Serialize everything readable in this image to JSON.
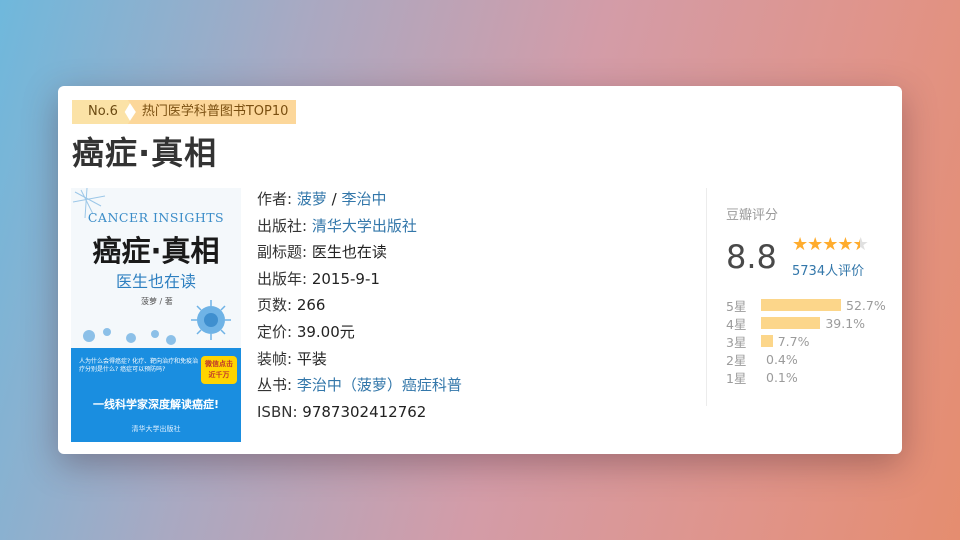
{
  "ranking": {
    "no": "No.6",
    "list": "热门医学科普图书TOP10"
  },
  "book": {
    "title": "癌症·真相",
    "cover": {
      "en_title": "CANCER INSIGHTS",
      "cn_title": "癌症·真相",
      "subtitle": "医生也在读",
      "author": "菠萝 / 著",
      "questions": "人为什么会得癌症? 化疗、靶向治疗和免疫治疗分别是什么? 癌症可以预防吗?",
      "badge": "微信点击 近千万",
      "slogan": "一线科学家深度解读癌症!",
      "publisher": "清华大学出版社"
    },
    "info": {
      "author_label": "作者: ",
      "author1": "菠萝",
      "author_sep": " / ",
      "author2": "李治中",
      "publisher_label": "出版社: ",
      "publisher": "清华大学出版社",
      "subtitle_label": "副标题: ",
      "subtitle": "医生也在读",
      "year_label": "出版年: ",
      "year": "2015-9-1",
      "pages_label": "页数: ",
      "pages": "266",
      "price_label": "定价: ",
      "price": "39.00元",
      "binding_label": "装帧: ",
      "binding": "平装",
      "series_label": "丛书: ",
      "series": "李治中（菠萝）癌症科普",
      "isbn_label": "ISBN: ",
      "isbn": "9787302412762"
    }
  },
  "rating": {
    "label": "豆瓣评分",
    "score": "8.8",
    "stars": 4.5,
    "votes": "5734人评价",
    "accent": "#ffac2d",
    "bar_color": "#fcd68a",
    "breakdown": [
      {
        "star": "5星",
        "percent": "52.7%",
        "value": 52.7
      },
      {
        "star": "4星",
        "percent": "39.1%",
        "value": 39.1
      },
      {
        "star": "3星",
        "percent": "7.7%",
        "value": 7.7
      },
      {
        "star": "2星",
        "percent": "0.4%",
        "value": 0.4
      },
      {
        "star": "1星",
        "percent": "0.1%",
        "value": 0.1
      }
    ]
  }
}
